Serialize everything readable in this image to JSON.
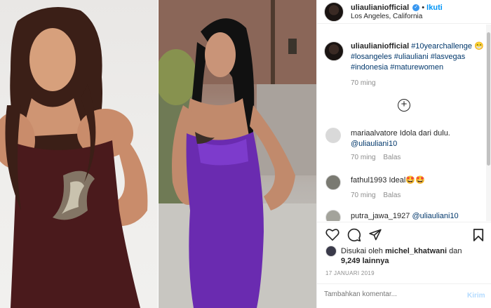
{
  "post": {
    "username": "uliaulianiofficial",
    "follow_label": "Ikuti",
    "location": "Los Angeles, California",
    "caption_hashtag_first": "#10yearchallenge",
    "caption_emoji": "😁",
    "caption_hashtags": "#losangeles #uliauliani #lasvegas #indonesia #maturewomen",
    "caption_time": "70 ming"
  },
  "comments": [
    {
      "username": "mariaalvatore",
      "text": "Idola dari dulu.",
      "mention": "@uliauliani10",
      "time": "70 ming",
      "reply": "Balas"
    },
    {
      "username": "fathul1993",
      "text": "Ideal🤩🤩",
      "time": "70 ming",
      "reply": "Balas"
    },
    {
      "username": "putra_jawa_1927",
      "mention": "@uliauliani10"
    }
  ],
  "likes": {
    "prefix": "Disukai oleh",
    "user": "michel_khatwani",
    "joiner": "dan",
    "others": "9,249 lainnya"
  },
  "date": "17 JANUARI 2019",
  "add_comment": {
    "placeholder": "Tambahkan komentar...",
    "post_label": "Kirim"
  },
  "icons": [
    "heart-icon",
    "comment-icon",
    "share-icon",
    "bookmark-icon",
    "add-circle-icon",
    "verified-badge-icon"
  ]
}
